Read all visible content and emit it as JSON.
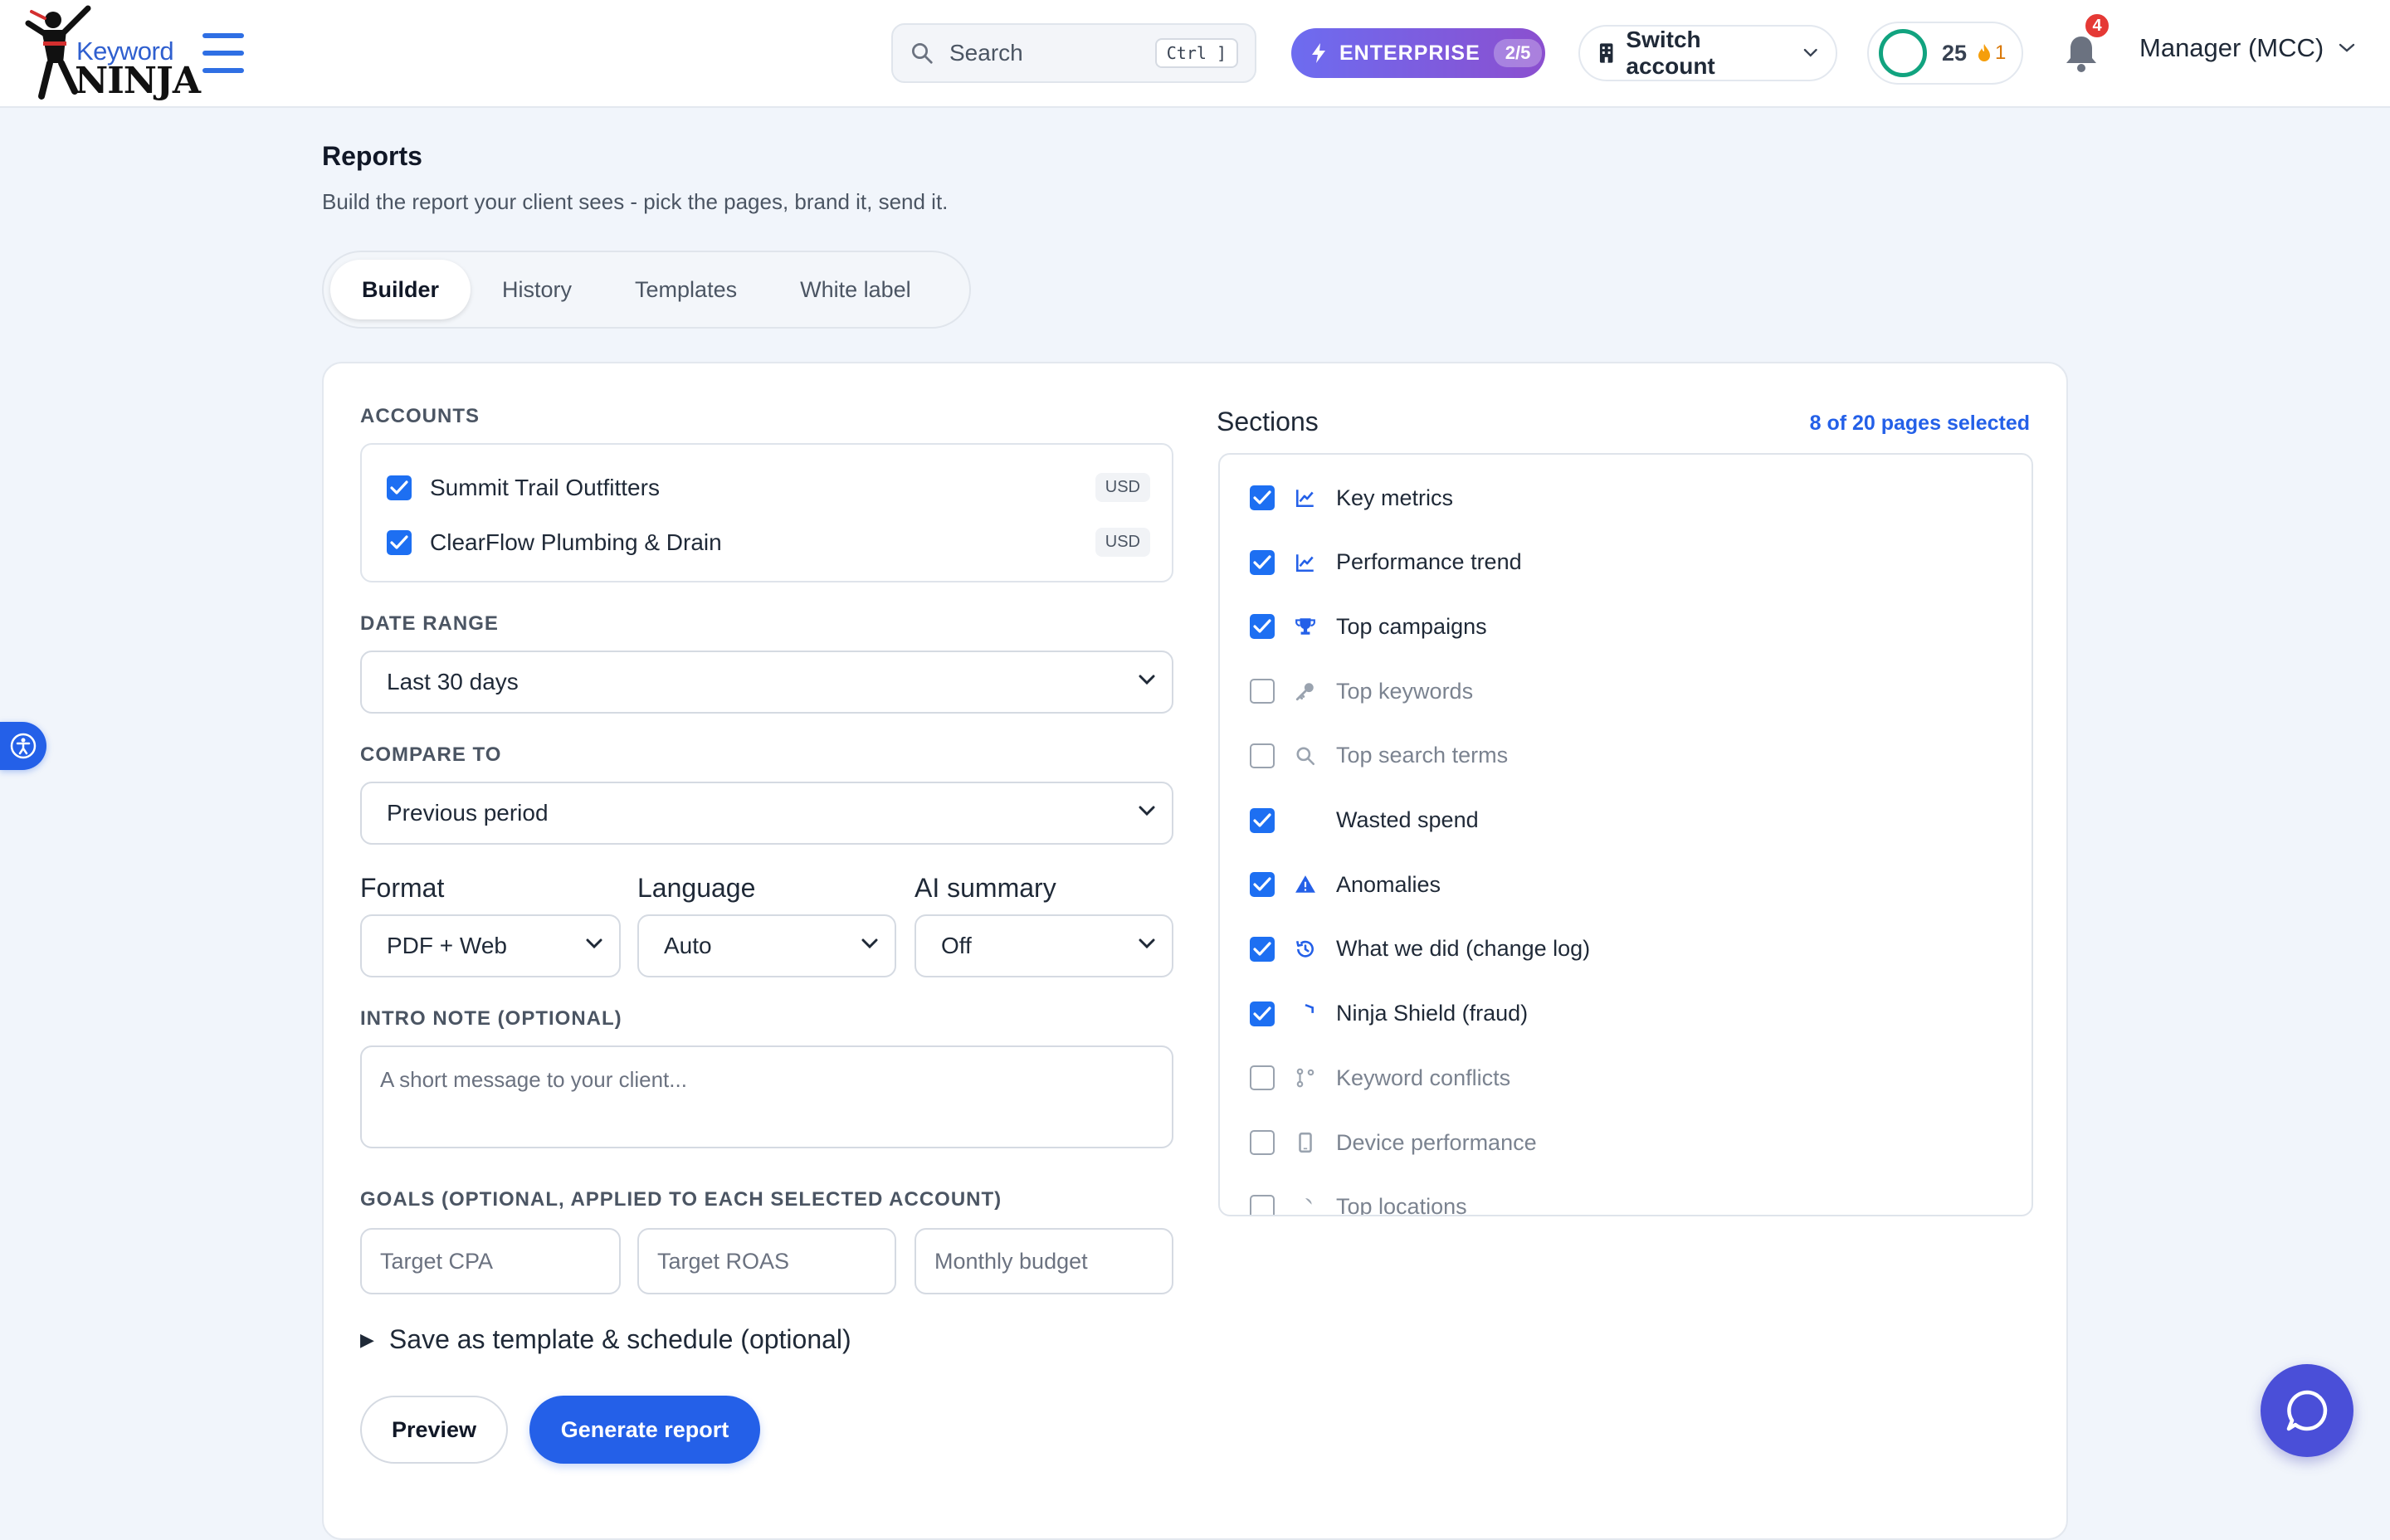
{
  "header": {
    "logo_word": "Keyword",
    "logo_ninja": "NINJA",
    "search_placeholder": "Search",
    "search_shortcut": "Ctrl ]",
    "plan_label": "ENTERPRISE",
    "plan_count": "2/5",
    "switch_account": "Switch account",
    "credits": "25",
    "streak": "1",
    "notifications_count": "4",
    "user_label": "Manager (MCC)"
  },
  "page": {
    "title": "Reports",
    "subtitle": "Build the report your client sees - pick the pages, brand it, send it."
  },
  "tabs": [
    {
      "label": "Builder",
      "active": true
    },
    {
      "label": "History",
      "active": false
    },
    {
      "label": "Templates",
      "active": false
    },
    {
      "label": "White label",
      "active": false
    }
  ],
  "form": {
    "accounts_label": "ACCOUNTS",
    "accounts": [
      {
        "name": "Summit Trail Outfitters",
        "currency": "USD",
        "checked": true
      },
      {
        "name": "ClearFlow Plumbing & Drain",
        "currency": "USD",
        "checked": true
      }
    ],
    "date_range_label": "DATE RANGE",
    "date_range_value": "Last 30 days",
    "compare_label": "COMPARE TO",
    "compare_value": "Previous period",
    "format_label": "Format",
    "format_value": "PDF + Web",
    "language_label": "Language",
    "language_value": "Auto",
    "ai_label": "AI summary",
    "ai_value": "Off",
    "intro_label": "INTRO NOTE (OPTIONAL)",
    "intro_placeholder": "A short message to your client...",
    "goals_label": "GOALS (OPTIONAL, APPLIED TO EACH SELECTED ACCOUNT)",
    "goal_cpa_placeholder": "Target CPA",
    "goal_roas_placeholder": "Target ROAS",
    "goal_budget_placeholder": "Monthly budget",
    "save_template_label": "Save as template & schedule (optional)",
    "preview_button": "Preview",
    "generate_button": "Generate report"
  },
  "sections": {
    "title": "Sections",
    "count_label": "8 of 20 pages selected",
    "items": [
      {
        "label": "Key metrics",
        "checked": true,
        "icon": "chart-line-icon"
      },
      {
        "label": "Performance trend",
        "checked": true,
        "icon": "chart-line-icon"
      },
      {
        "label": "Top campaigns",
        "checked": true,
        "icon": "trophy-icon"
      },
      {
        "label": "Top keywords",
        "checked": false,
        "icon": "key-icon"
      },
      {
        "label": "Top search terms",
        "checked": false,
        "icon": "search-icon"
      },
      {
        "label": "Wasted spend",
        "checked": true,
        "icon": "flame-icon"
      },
      {
        "label": "Anomalies",
        "checked": true,
        "icon": "warning-icon"
      },
      {
        "label": "What we did (change log)",
        "checked": true,
        "icon": "history-icon"
      },
      {
        "label": "Ninja Shield (fraud)",
        "checked": true,
        "icon": "shield-icon"
      },
      {
        "label": "Keyword conflicts",
        "checked": false,
        "icon": "branch-icon"
      },
      {
        "label": "Device performance",
        "checked": false,
        "icon": "mobile-icon"
      },
      {
        "label": "Top locations",
        "checked": false,
        "icon": "location-icon"
      }
    ]
  },
  "colors": {
    "accent": "#2460e8",
    "enterprise_start": "#6d6cf0",
    "enterprise_end": "#8b4fcf",
    "credit_ring": "#11a37f",
    "badge": "#e53935"
  }
}
